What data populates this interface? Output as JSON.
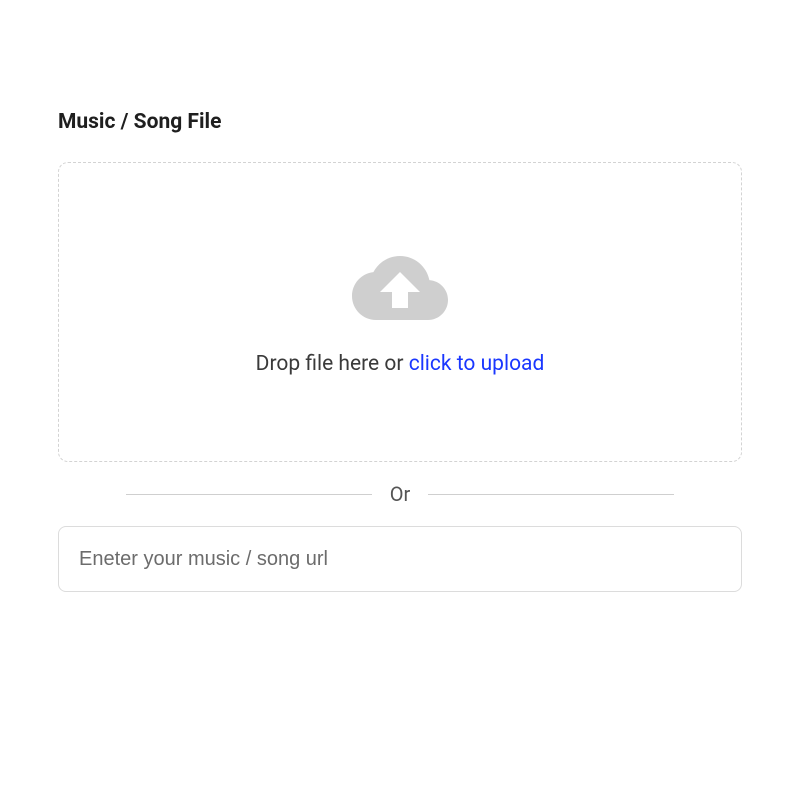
{
  "section": {
    "title": "Music / Song File"
  },
  "upload": {
    "drop_prefix": "Drop file here or ",
    "drop_link": "click to upload",
    "icon_name": "cloud-upload-icon"
  },
  "divider": {
    "text": "Or"
  },
  "url": {
    "placeholder": "Eneter your music / song url",
    "value": ""
  },
  "colors": {
    "link": "#1a37ff",
    "border": "#d3d3d3",
    "icon_fill": "#cfcfcf"
  }
}
